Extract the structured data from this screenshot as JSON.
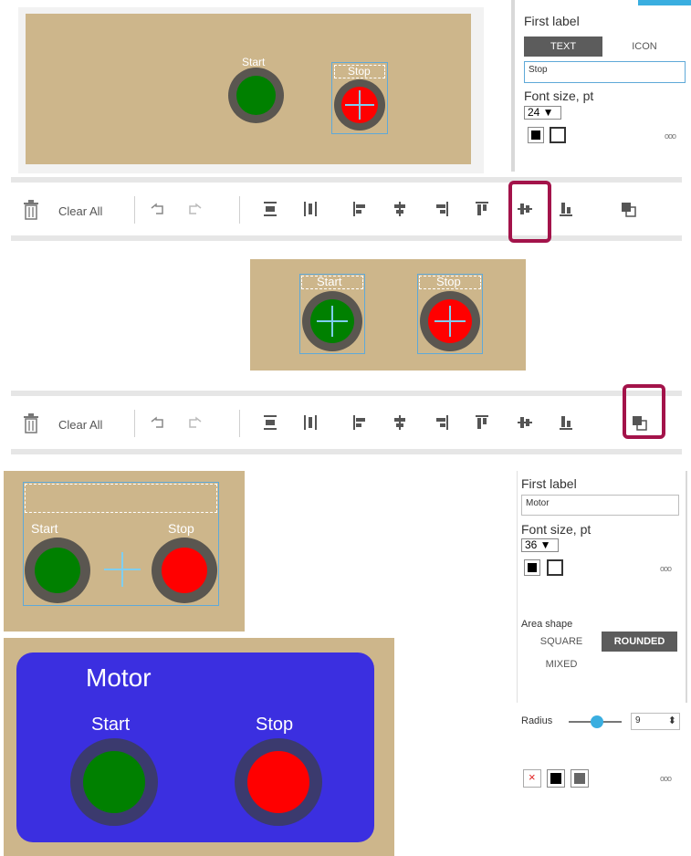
{
  "colors": {
    "tan": "#cdb68b",
    "green": "#008000",
    "red": "#ff0000",
    "ring": "#5a5650",
    "selection": "#5fa9d8",
    "highlight": "#a3134a",
    "motor_panel": "#3b2fe0",
    "ring_motor": "#3b3a6e"
  },
  "panel_top": {
    "first_label": "First label",
    "tab_text": "TEXT",
    "tab_icon": "ICON",
    "input_value": "Stop",
    "font_size_label": "Font size, pt",
    "font_size_value": "24 ▼",
    "more": "ooo"
  },
  "canvas1": {
    "start_label": "Start",
    "stop_label": "Stop"
  },
  "toolbar": {
    "clear_all": "Clear All"
  },
  "canvas2": {
    "start_label": "Start",
    "stop_label": "Stop"
  },
  "canvas3": {
    "start_label": "Start",
    "stop_label": "Stop"
  },
  "panel_bottom": {
    "first_label": "First label",
    "input_value": "Motor",
    "font_size_label": "Font size, pt",
    "font_size_value": "36 ▼",
    "more": "ooo",
    "area_shape_label": "Area shape",
    "shape_square": "SQUARE",
    "shape_rounded": "ROUNDED",
    "shape_mixed": "MIXED",
    "radius_label": "Radius",
    "radius_value": "9",
    "radius_fraction": 0.5,
    "spinner": "⬍",
    "swatch_none": "×",
    "more2": "ooo"
  },
  "canvas4": {
    "title": "Motor",
    "start_label": "Start",
    "stop_label": "Stop"
  }
}
